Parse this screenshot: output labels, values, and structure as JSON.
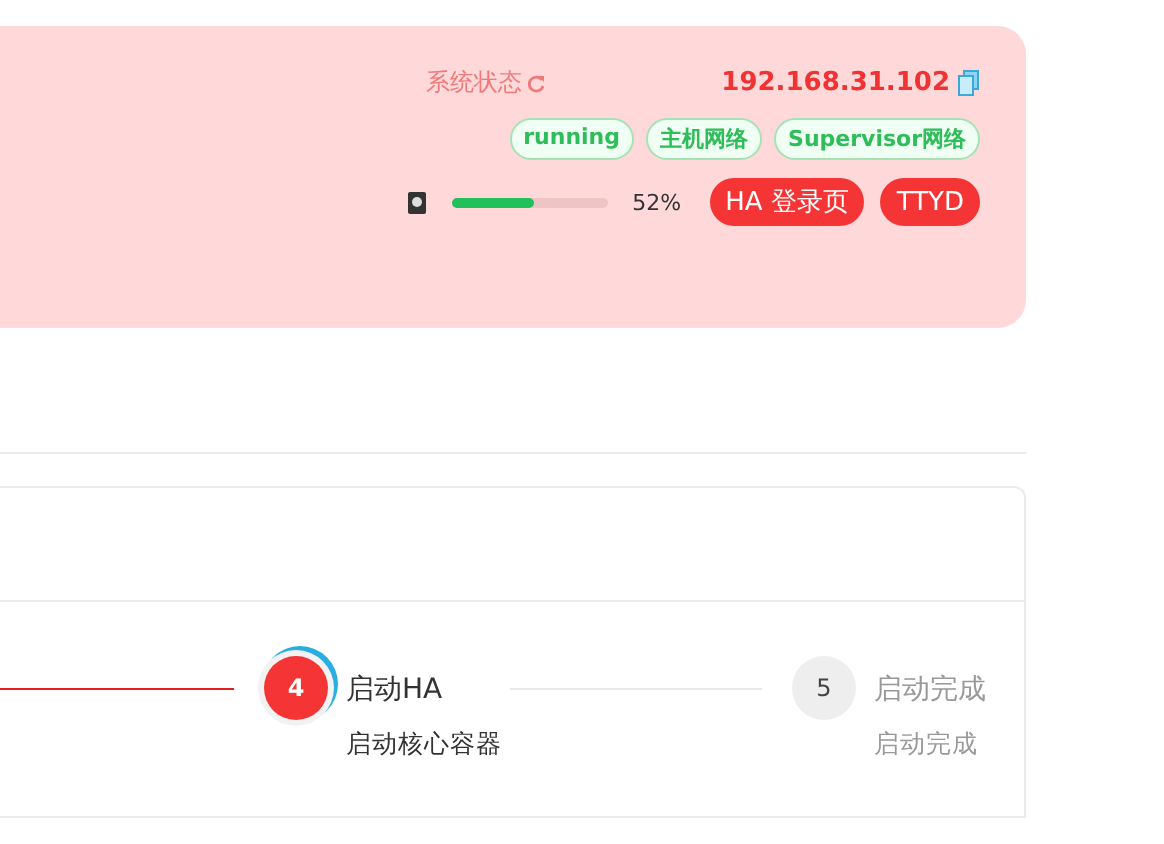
{
  "status_panel": {
    "status_label": "系统状态",
    "ip": "192.168.31.102",
    "tags": [
      "running",
      "主机网络",
      "Supervisor网络"
    ],
    "disk": {
      "level": 0.52,
      "reading": "52%"
    },
    "buttons": [
      "HA 登录页",
      "TTYD"
    ]
  },
  "steps": [
    {
      "number": "4",
      "title": "启动HA",
      "description": "启动核心容器",
      "active": true
    },
    {
      "number": "5",
      "title": "启动完成",
      "description": "启动完成",
      "active": false
    }
  ]
}
